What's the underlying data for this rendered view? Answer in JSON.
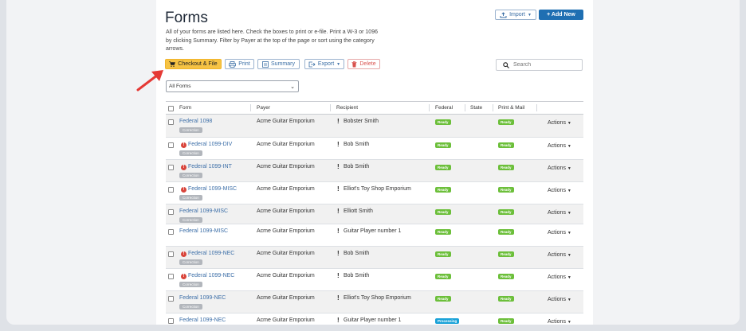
{
  "header": {
    "title": "Forms",
    "description": "All of your forms are listed here. Check the boxes to print or e-file. Print a W-3 or 1096 by clicking Summary. Filter by Payer at the top of the page or sort using the category arrows."
  },
  "toolbar": {
    "import_label": "Import",
    "add_new_label": "+ Add New",
    "checkout_label": "Checkout & File",
    "print_label": "Print",
    "summary_label": "Summary",
    "export_label": "Export",
    "delete_label": "Delete"
  },
  "search": {
    "placeholder": "Search"
  },
  "filter": {
    "selected": "All Forms"
  },
  "table": {
    "headers": [
      "Form",
      "Payer",
      "Recipient",
      "Federal",
      "State",
      "Print & Mail"
    ],
    "actions_label": "Actions",
    "rows": [
      {
        "form": "Federal 1098",
        "error": false,
        "correction": "Correction",
        "payer": "Acme Guitar Emporium",
        "recipient": "Bobster Smith",
        "federal": "Ready",
        "print_mail": "Ready"
      },
      {
        "form": "Federal 1099-DIV",
        "error": true,
        "correction": "Correction",
        "payer": "Acme Guitar Emporium",
        "recipient": "Bob Smith",
        "federal": "Ready",
        "print_mail": "Ready"
      },
      {
        "form": "Federal 1099-INT",
        "error": true,
        "correction": "Correction",
        "payer": "Acme Guitar Emporium",
        "recipient": "Bob Smith",
        "federal": "Ready",
        "print_mail": "Ready"
      },
      {
        "form": "Federal 1099-MISC",
        "error": true,
        "correction": "Correction",
        "payer": "Acme Guitar Emporium",
        "recipient": "Elliot's Toy Shop Emporium",
        "federal": "Ready",
        "print_mail": "Ready"
      },
      {
        "form": "Federal 1099-MISC",
        "error": false,
        "correction": "Correction",
        "payer": "Acme Guitar Emporium",
        "recipient": "Elliott Smith",
        "federal": "Ready",
        "print_mail": "Ready"
      },
      {
        "form": "Federal 1099-MISC",
        "error": false,
        "correction": "",
        "payer": "Acme Guitar Emporium",
        "recipient": "Guitar Player number 1",
        "federal": "Ready",
        "print_mail": "Ready"
      },
      {
        "form": "Federal 1099-NEC",
        "error": true,
        "correction": "Correction",
        "payer": "Acme Guitar Emporium",
        "recipient": "Bob Smith",
        "federal": "Ready",
        "print_mail": "Ready"
      },
      {
        "form": "Federal 1099-NEC",
        "error": true,
        "correction": "Correction",
        "payer": "Acme Guitar Emporium",
        "recipient": "Bob Smith",
        "federal": "Ready",
        "print_mail": "Ready"
      },
      {
        "form": "Federal 1099-NEC",
        "error": false,
        "correction": "Correction",
        "payer": "Acme Guitar Emporium",
        "recipient": "Elliot's Toy Shop Emporium",
        "federal": "Ready",
        "print_mail": "Ready"
      },
      {
        "form": "Federal 1099-NEC",
        "error": false,
        "correction": "",
        "payer": "Acme Guitar Emporium",
        "recipient": "Guitar Player number 1",
        "federal": "Processing",
        "print_mail": "Ready"
      }
    ]
  },
  "colors": {
    "accent": "#1f6fb2",
    "checkout": "#f6c344",
    "ready": "#6cbf3a",
    "processing": "#1aa2d8",
    "error": "#d9443b",
    "annotation_arrow": "#e53935"
  },
  "icons": [
    "upload-icon",
    "cart-icon",
    "printer-icon",
    "summary-icon",
    "export-icon",
    "trash-icon",
    "search-icon",
    "error-icon",
    "warning-icon",
    "caret-down-icon"
  ]
}
